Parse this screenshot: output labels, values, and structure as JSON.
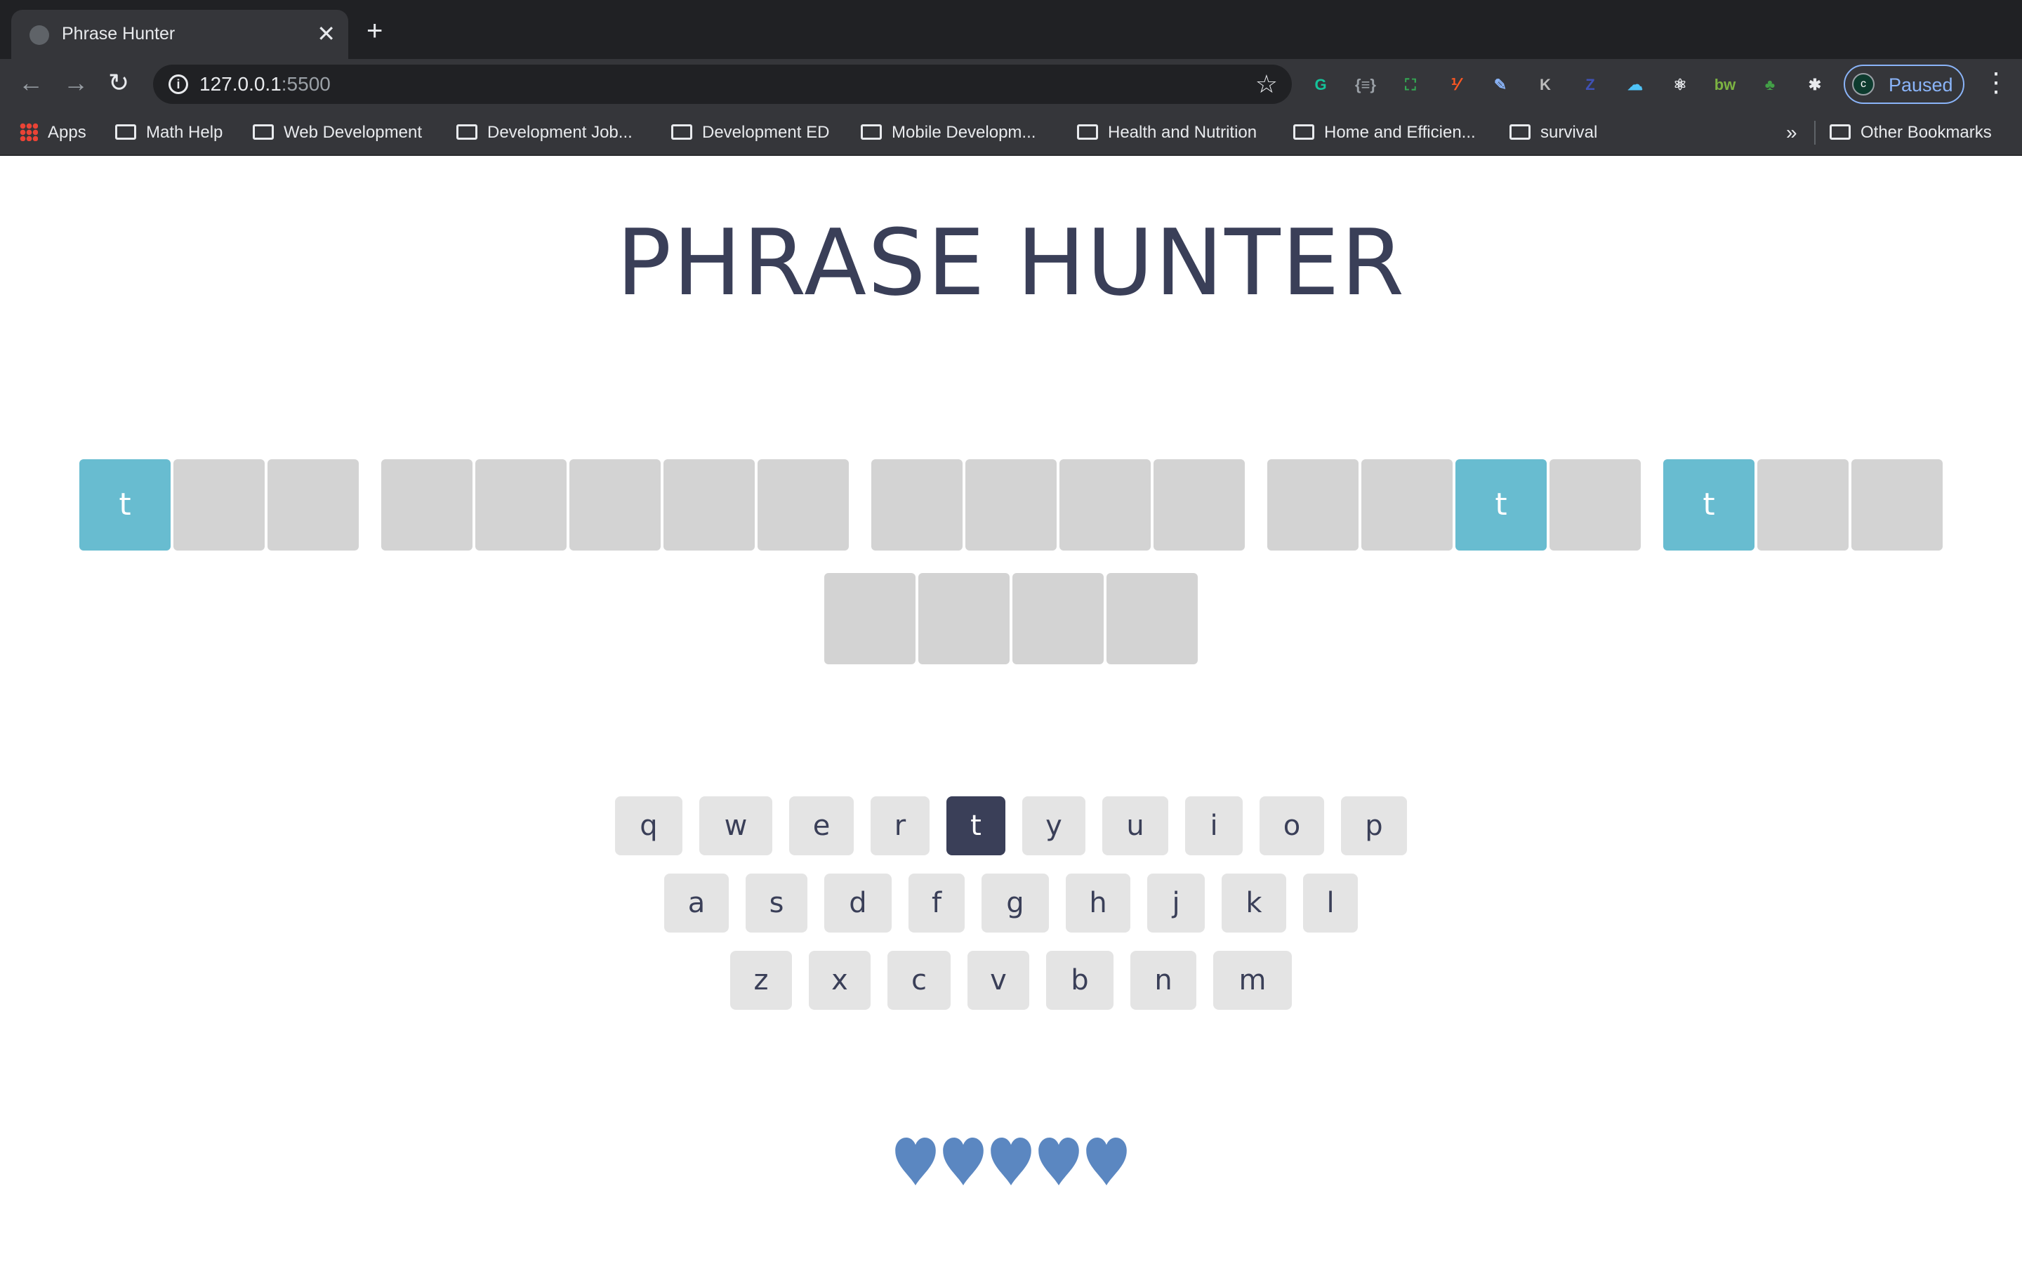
{
  "browser": {
    "tab_title": "Phrase Hunter",
    "tab_close": "✕",
    "new_tab": "+",
    "nav": {
      "back": "←",
      "forward": "→",
      "reload": "↻"
    },
    "url_host": "127.0.0.1",
    "url_port": ":5500",
    "info_glyph": "i",
    "star_glyph": "☆",
    "extensions": [
      {
        "name": "grammarly-extension-icon",
        "glyph": "G",
        "color": "#15c39a"
      },
      {
        "name": "json-extension-icon",
        "glyph": "{≡}",
        "color": "#9aa0a6"
      },
      {
        "name": "screenshot-extension-icon",
        "glyph": "⛶",
        "color": "#34a853"
      },
      {
        "name": "translate-extension-icon",
        "glyph": "⅟",
        "color": "#ff5722"
      },
      {
        "name": "color-picker-extension-icon",
        "glyph": "✎",
        "color": "#8ab4f8"
      },
      {
        "name": "kami-extension-icon",
        "glyph": "K",
        "color": "#bdbdbd"
      },
      {
        "name": "zotero-extension-icon",
        "glyph": "Z",
        "color": "#3f51b5"
      },
      {
        "name": "cloud-extension-icon",
        "glyph": "☁",
        "color": "#4fc3f7"
      },
      {
        "name": "react-devtools-extension-icon",
        "glyph": "⚛",
        "color": "#e8eaed"
      },
      {
        "name": "bw-extension-icon",
        "glyph": "bw",
        "color": "#7cb342"
      },
      {
        "name": "tree-extension-icon",
        "glyph": "♣",
        "color": "#43a047"
      },
      {
        "name": "puzzle-extensions-icon",
        "glyph": "✱",
        "color": "#e8eaed"
      }
    ],
    "profile_initial": "c",
    "profile_status": "Paused",
    "menu_glyph": "⋮",
    "bookmarks": [
      {
        "label": "Apps",
        "type": "apps"
      },
      {
        "label": "Math Help",
        "type": "folder"
      },
      {
        "label": "Web Development",
        "type": "folder"
      },
      {
        "label": "Development Job...",
        "type": "folder"
      },
      {
        "label": "Development ED",
        "type": "folder"
      },
      {
        "label": "Mobile Developm...",
        "type": "folder"
      },
      {
        "label": "Health and Nutrition",
        "type": "folder"
      },
      {
        "label": "Home and Efficien...",
        "type": "folder"
      },
      {
        "label": "survival",
        "type": "folder"
      }
    ],
    "bookmarks_overflow": "»",
    "other_bookmarks": "Other Bookmarks"
  },
  "game": {
    "title": "PHRASE HUNTER",
    "phrase_words": [
      [
        {
          "char": "t",
          "shown": true
        },
        {
          "char": "",
          "shown": false
        },
        {
          "char": "",
          "shown": false
        }
      ],
      [
        {
          "char": "",
          "shown": false
        },
        {
          "char": "",
          "shown": false
        },
        {
          "char": "",
          "shown": false
        },
        {
          "char": "",
          "shown": false
        },
        {
          "char": "",
          "shown": false
        }
      ],
      [
        {
          "char": "",
          "shown": false
        },
        {
          "char": "",
          "shown": false
        },
        {
          "char": "",
          "shown": false
        },
        {
          "char": "",
          "shown": false
        }
      ],
      [
        {
          "char": "",
          "shown": false
        },
        {
          "char": "",
          "shown": false
        },
        {
          "char": "t",
          "shown": true
        },
        {
          "char": "",
          "shown": false
        }
      ],
      [
        {
          "char": "t",
          "shown": true
        },
        {
          "char": "",
          "shown": false
        },
        {
          "char": "",
          "shown": false
        }
      ],
      [
        {
          "char": "",
          "shown": false
        },
        {
          "char": "",
          "shown": false
        },
        {
          "char": "",
          "shown": false
        },
        {
          "char": "",
          "shown": false
        }
      ]
    ],
    "keyboard_rows": [
      [
        "q",
        "w",
        "e",
        "r",
        "t",
        "y",
        "u",
        "i",
        "o",
        "p"
      ],
      [
        "a",
        "s",
        "d",
        "f",
        "g",
        "h",
        "j",
        "k",
        "l"
      ],
      [
        "z",
        "x",
        "c",
        "v",
        "b",
        "n",
        "m"
      ]
    ],
    "chosen_keys": [
      "t"
    ],
    "lives_remaining": 5,
    "heart_color": "#5b87c1"
  }
}
